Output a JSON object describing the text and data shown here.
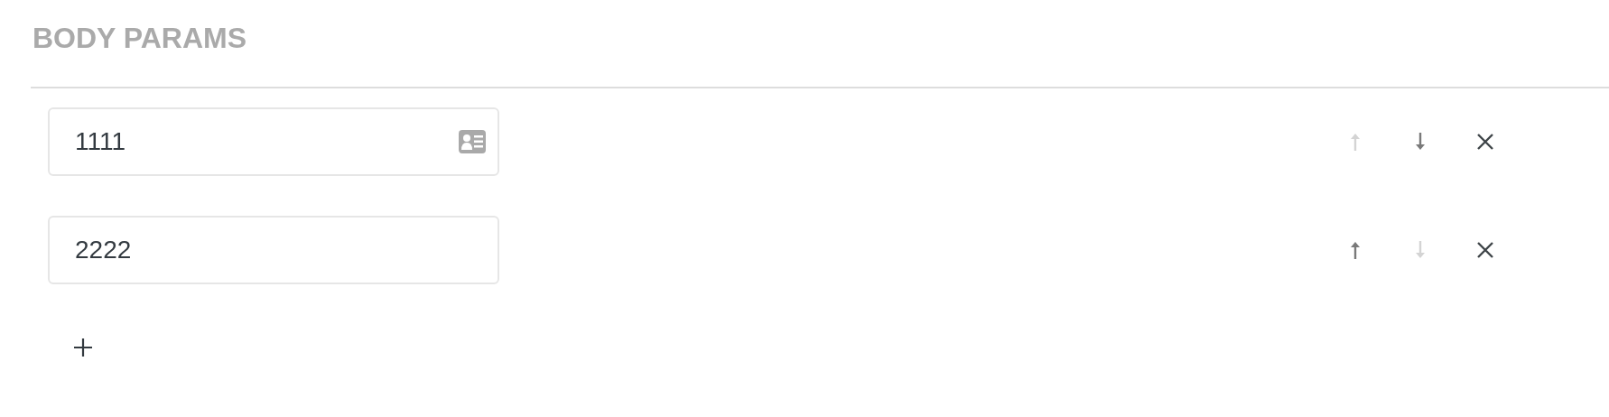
{
  "section": {
    "title": "BODY PARAMS"
  },
  "params": [
    {
      "value": "1111",
      "has_card_icon": true,
      "up_disabled": true,
      "down_disabled": false
    },
    {
      "value": "2222",
      "has_card_icon": false,
      "up_disabled": false,
      "down_disabled": true
    }
  ]
}
